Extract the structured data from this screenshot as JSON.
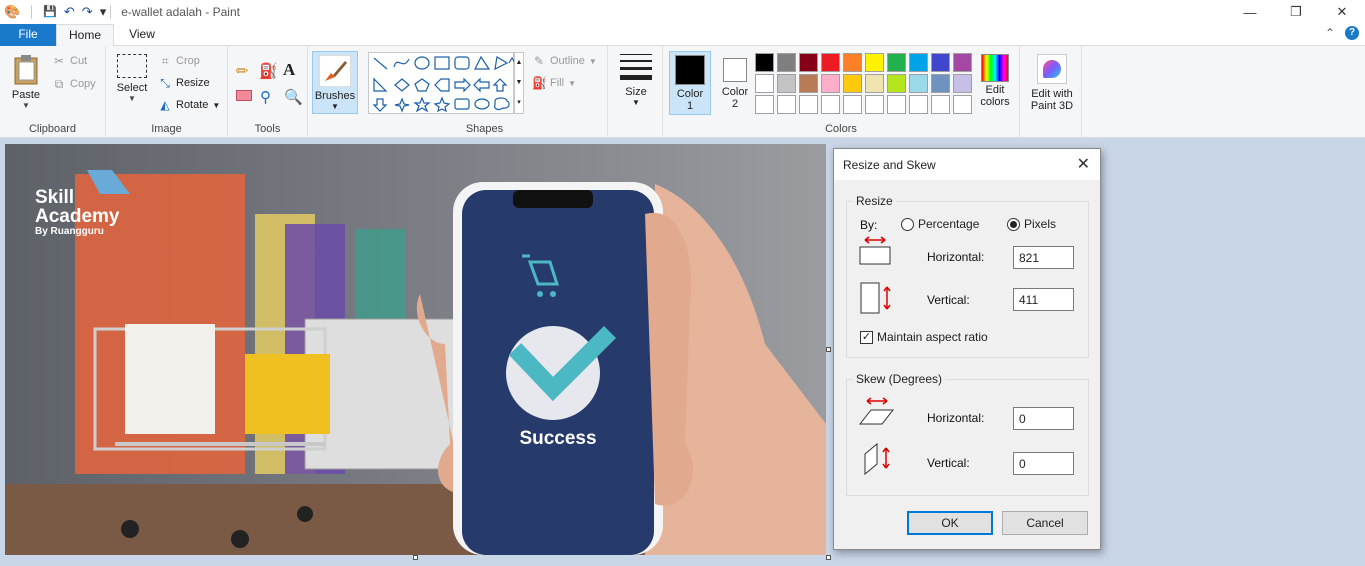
{
  "window": {
    "title": "e-wallet adalah - Paint",
    "minimize": "—",
    "maximize": "❐",
    "close": "✕"
  },
  "quick_access": {
    "save": "💾",
    "undo": "↶",
    "redo": "↷",
    "customize": "▾"
  },
  "tabs": {
    "file": "File",
    "home": "Home",
    "view": "View",
    "collapse": "⌃",
    "help": "?"
  },
  "clipboard": {
    "paste": "Paste",
    "cut": "Cut",
    "copy": "Copy",
    "label": "Clipboard"
  },
  "image": {
    "select": "Select",
    "crop": "Crop",
    "resize": "Resize",
    "rotate": "Rotate",
    "label": "Image"
  },
  "tools": {
    "label": "Tools"
  },
  "brushes": {
    "label": "Brushes"
  },
  "shapes": {
    "outline": "Outline",
    "fill": "Fill",
    "label": "Shapes"
  },
  "size": {
    "label": "Size"
  },
  "colors": {
    "color1": "Color",
    "color1_num": "1",
    "color2": "Color",
    "color2_num": "2",
    "edit_colors_1": "Edit",
    "edit_colors_2": "colors",
    "label": "Colors",
    "color1_value": "#000000",
    "color2_value": "#ffffff",
    "row1": [
      "#000000",
      "#7f7f7f",
      "#880015",
      "#ed1c24",
      "#ff7f27",
      "#fff200",
      "#22b14c",
      "#00a2e8",
      "#3f48cc",
      "#a349a4"
    ],
    "row2": [
      "#ffffff",
      "#c3c3c3",
      "#b97a57",
      "#ffaec9",
      "#ffc90e",
      "#efe4b0",
      "#b5e61d",
      "#99d9ea",
      "#7092be",
      "#c8bfe7"
    ],
    "row3": [
      "#ffffff",
      "#ffffff",
      "#ffffff",
      "#ffffff",
      "#ffffff",
      "#ffffff",
      "#ffffff",
      "#ffffff",
      "#ffffff",
      "#ffffff"
    ]
  },
  "paint3d": {
    "line1": "Edit with",
    "line2": "Paint 3D"
  },
  "canvas_image": {
    "brand_line1": "Skill",
    "brand_line2": "Academy",
    "brand_line3": "By Ruangguru",
    "status": "Success"
  },
  "dialog": {
    "title": "Resize and Skew",
    "close": "✕",
    "resize_legend": "Resize",
    "by": "By:",
    "percentage": "Percentage",
    "pixels": "Pixels",
    "horizontal": "Horizontal:",
    "vertical": "Vertical:",
    "resize_h": "821",
    "resize_v": "411",
    "maintain": "Maintain aspect ratio",
    "skew_legend": "Skew (Degrees)",
    "skew_h": "0",
    "skew_v": "0",
    "ok": "OK",
    "cancel": "Cancel"
  }
}
